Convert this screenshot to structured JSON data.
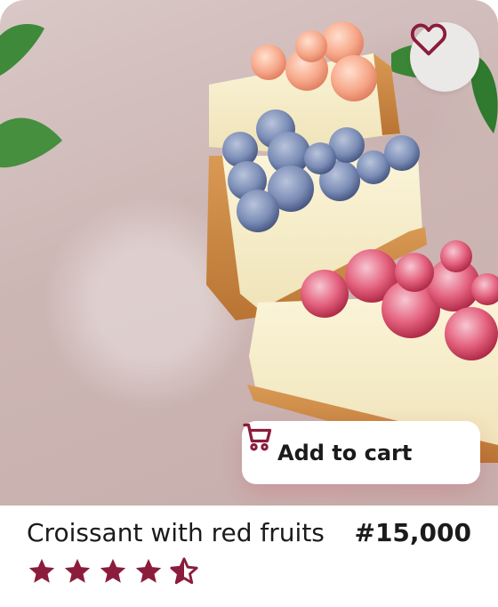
{
  "product": {
    "name": "Croissant with red fruits",
    "price": "#15,000",
    "rating": 4.5,
    "rating_max": 5,
    "add_to_cart_label": "Add to cart"
  },
  "icons": {
    "favorite": "heart-outline-icon",
    "cart": "shopping-cart-icon",
    "star": "star-icon"
  },
  "colors": {
    "accent": "#8b1c3b",
    "button_bg": "#ffffff",
    "favorite_bg": "#ebe8e8"
  }
}
